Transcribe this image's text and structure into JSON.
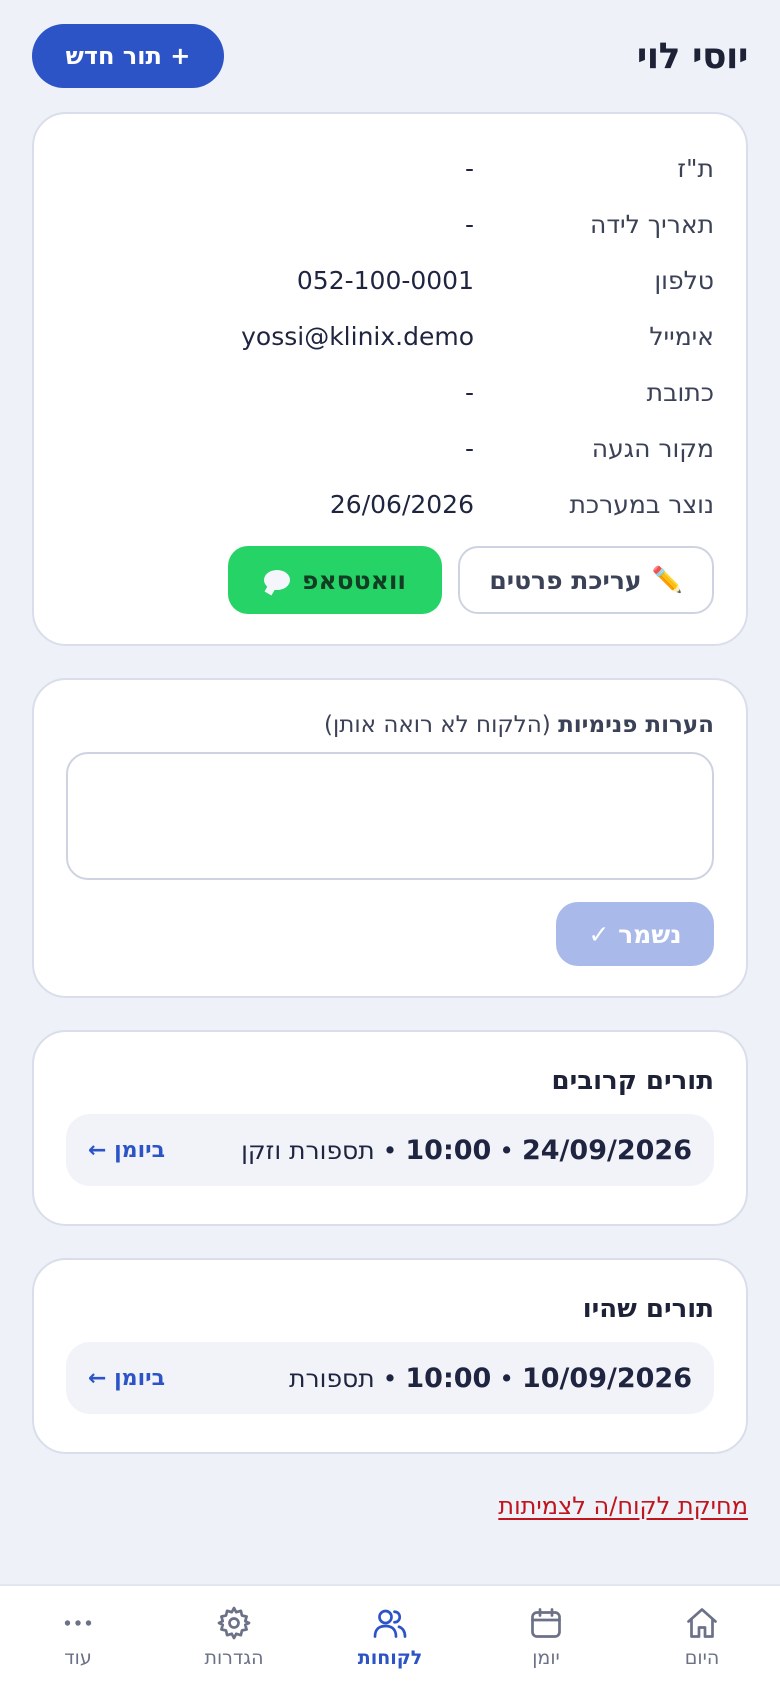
{
  "header": {
    "client_name": "יוסי לוי",
    "new_appointment_label": "+ תור חדש"
  },
  "details": [
    {
      "label": "ת\"ז",
      "value": "-"
    },
    {
      "label": "תאריך לידה",
      "value": "-"
    },
    {
      "label": "טלפון",
      "value": "052-100-0001"
    },
    {
      "label": "אימייל",
      "value": "yossi@klinix.demo"
    },
    {
      "label": "כתובת",
      "value": "-"
    },
    {
      "label": "מקור הגעה",
      "value": "-"
    },
    {
      "label": "נוצר במערכת",
      "value": "26/06/2026"
    }
  ],
  "actions": {
    "edit_label": "עריכת פרטים",
    "whatsapp_label": "וואטסאפ"
  },
  "notes": {
    "title_bold": "הערות פנימיות",
    "title_note": "(הלקוח לא רואה אותן)",
    "value": "",
    "save_label": "נשמר ✓"
  },
  "upcoming": {
    "title": "תורים קרובים",
    "date": "24/09/2026",
    "time": "10:00",
    "service": "תספורת וזקן",
    "link_label": "ביומן ←"
  },
  "past": {
    "title": "תורים שהיו",
    "date": "10/09/2026",
    "time": "10:00",
    "service": "תספורת",
    "link_label": "ביומן ←"
  },
  "delete_label": "מחיקת לקוח/ה לצמיתות",
  "nav": [
    {
      "label": "היום",
      "icon": "home-icon",
      "active": false
    },
    {
      "label": "יומן",
      "icon": "calendar-icon",
      "active": false
    },
    {
      "label": "לקוחות",
      "icon": "users-icon",
      "active": true
    },
    {
      "label": "הגדרות",
      "icon": "gear-icon",
      "active": false
    },
    {
      "label": "עוד",
      "icon": "more-icon",
      "active": false
    }
  ],
  "colors": {
    "primary": "#2c54c6",
    "whatsapp": "#25d366",
    "danger": "#c0151d",
    "background": "#eef1f8"
  }
}
